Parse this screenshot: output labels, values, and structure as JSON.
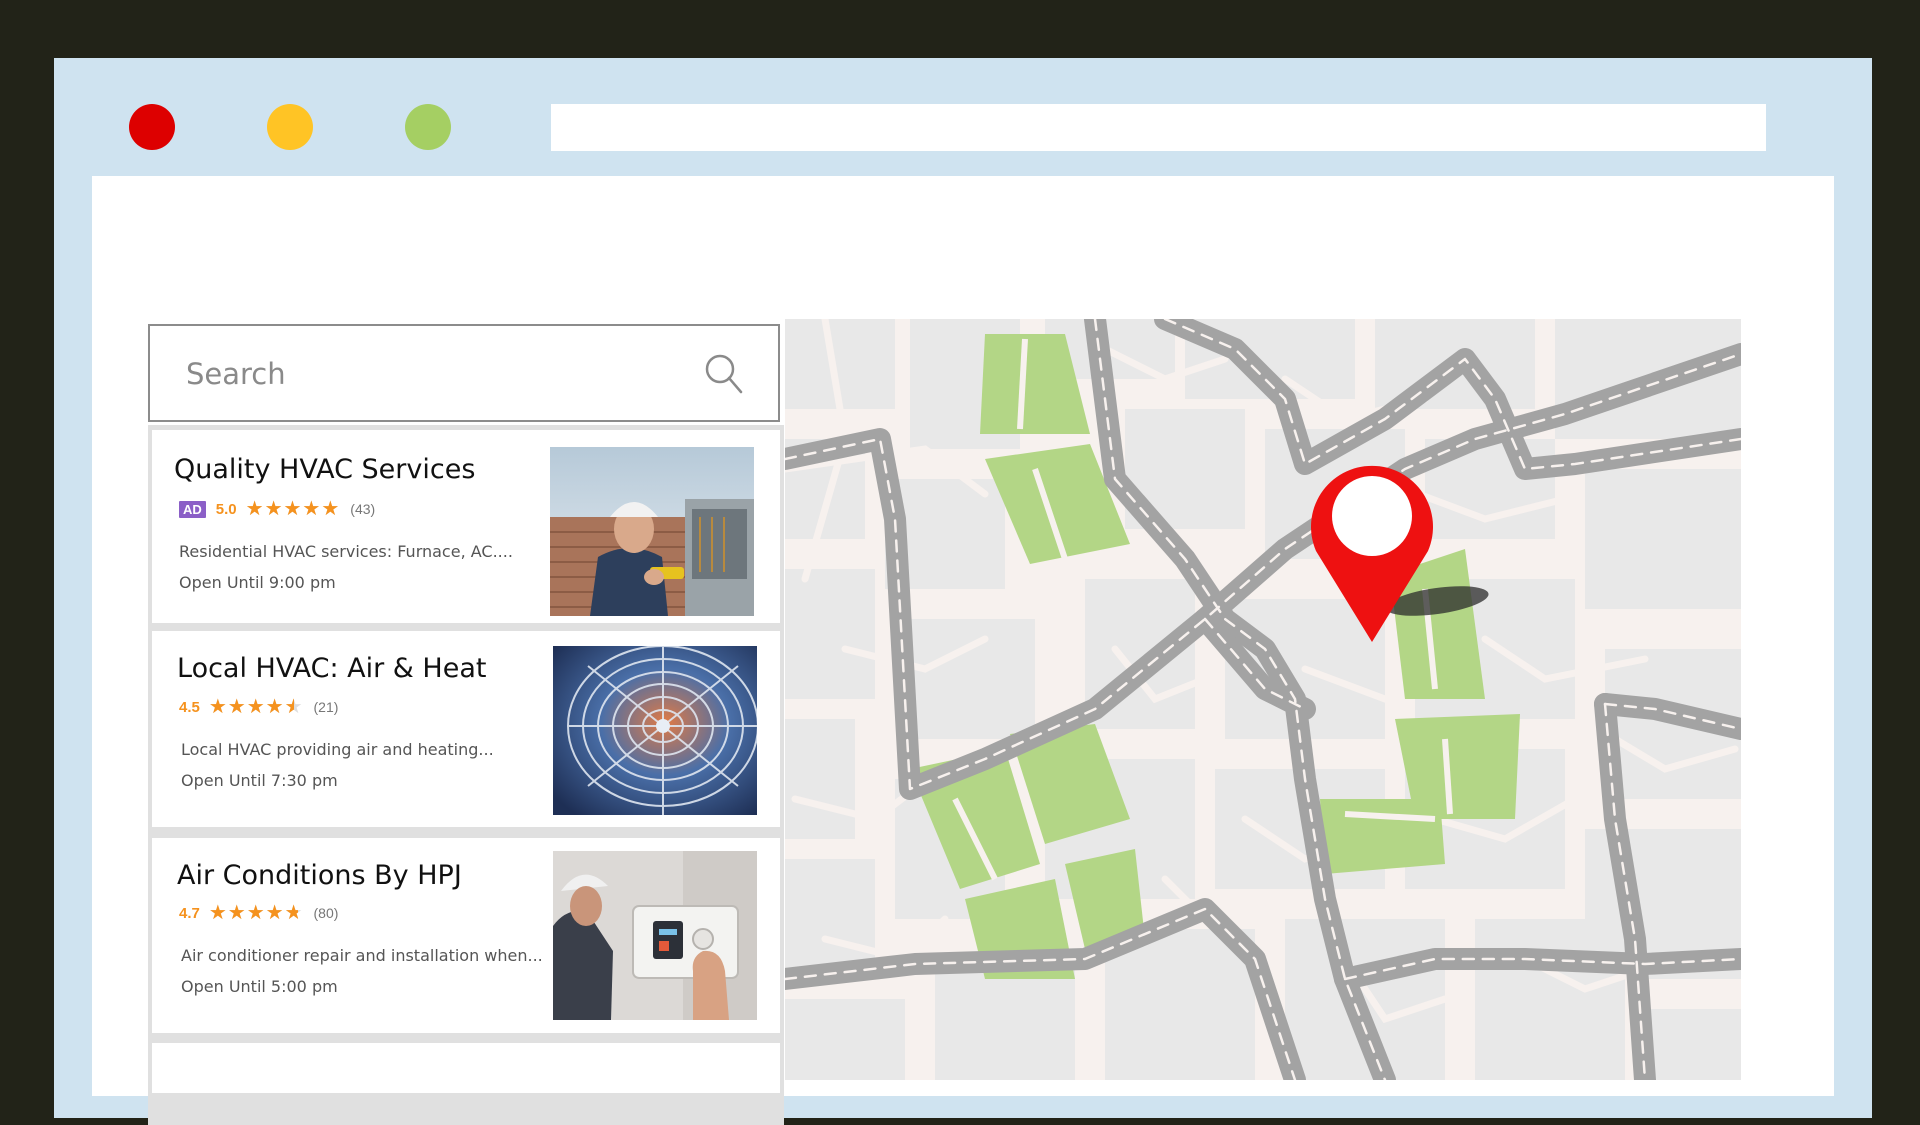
{
  "window": {
    "controls": [
      {
        "name": "close",
        "color": "#dd0000"
      },
      {
        "name": "minimize",
        "color": "#ffc425"
      },
      {
        "name": "maximize",
        "color": "#a5cf63"
      }
    ],
    "address_bar": {
      "value": ""
    }
  },
  "search": {
    "placeholder": "Search",
    "icon": "search-icon"
  },
  "listings": [
    {
      "title": "Quality HVAC Services",
      "ad_badge": "AD",
      "rating": "5.0",
      "stars": 5.0,
      "reviews": "(43)",
      "description": "Residential HVAC services: Furnace, AC....",
      "hours": "Open Until 9:00 pm",
      "image": "technician-outdoor-unit"
    },
    {
      "title": "Local HVAC: Air & Heat",
      "rating": "4.5",
      "stars": 4.5,
      "reviews": "(21)",
      "description": "Local HVAC providing air and heating...",
      "hours": "Open Until 7:30 pm",
      "image": "ac-fan-closeup"
    },
    {
      "title": "Air Conditions By HPJ",
      "rating": "4.7",
      "stars": 4.7,
      "reviews": "(80)",
      "description": "Air conditioner repair and installation when...",
      "hours": "Open Until 5:00 pm",
      "image": "thermostat-adjustment"
    }
  ],
  "map": {
    "marker": "location-pin-icon",
    "colors": {
      "background": "#f7f1ee",
      "block": "#e8e8e8",
      "park": "#b3d686",
      "road": "#a3a3a3",
      "pin": "#ee1111"
    }
  }
}
